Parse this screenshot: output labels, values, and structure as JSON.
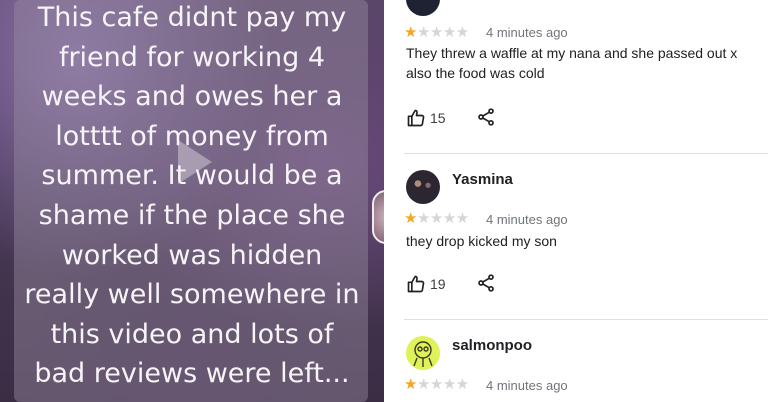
{
  "video": {
    "caption_lines": [
      "This cafe didnt pay my",
      "friend for working 4",
      "weeks and owes her a",
      "lotttt of money from",
      "summer. It would be a",
      "shame if the place she",
      "worked was hidden",
      "really well somewhere in",
      "this video and lots of",
      "bad reviews were left..."
    ]
  },
  "reviews": [
    {
      "name": "",
      "rating": 1,
      "time": "4 minutes ago",
      "text": "They threw a waffle at my nana and she passed out x also the food was cold",
      "likes": "15"
    },
    {
      "name": "Yasmina",
      "rating": 1,
      "time": "4 minutes ago",
      "text": "they drop kicked my son",
      "likes": "19"
    },
    {
      "name": "salmonpoo",
      "rating": 1,
      "time": "4 minutes ago",
      "text": "",
      "likes": ""
    }
  ],
  "colors": {
    "star_filled": "#f5a623",
    "star_empty": "#d6d6d6"
  },
  "icons": {
    "like": "thumbs-up-icon",
    "share": "share-icon"
  }
}
